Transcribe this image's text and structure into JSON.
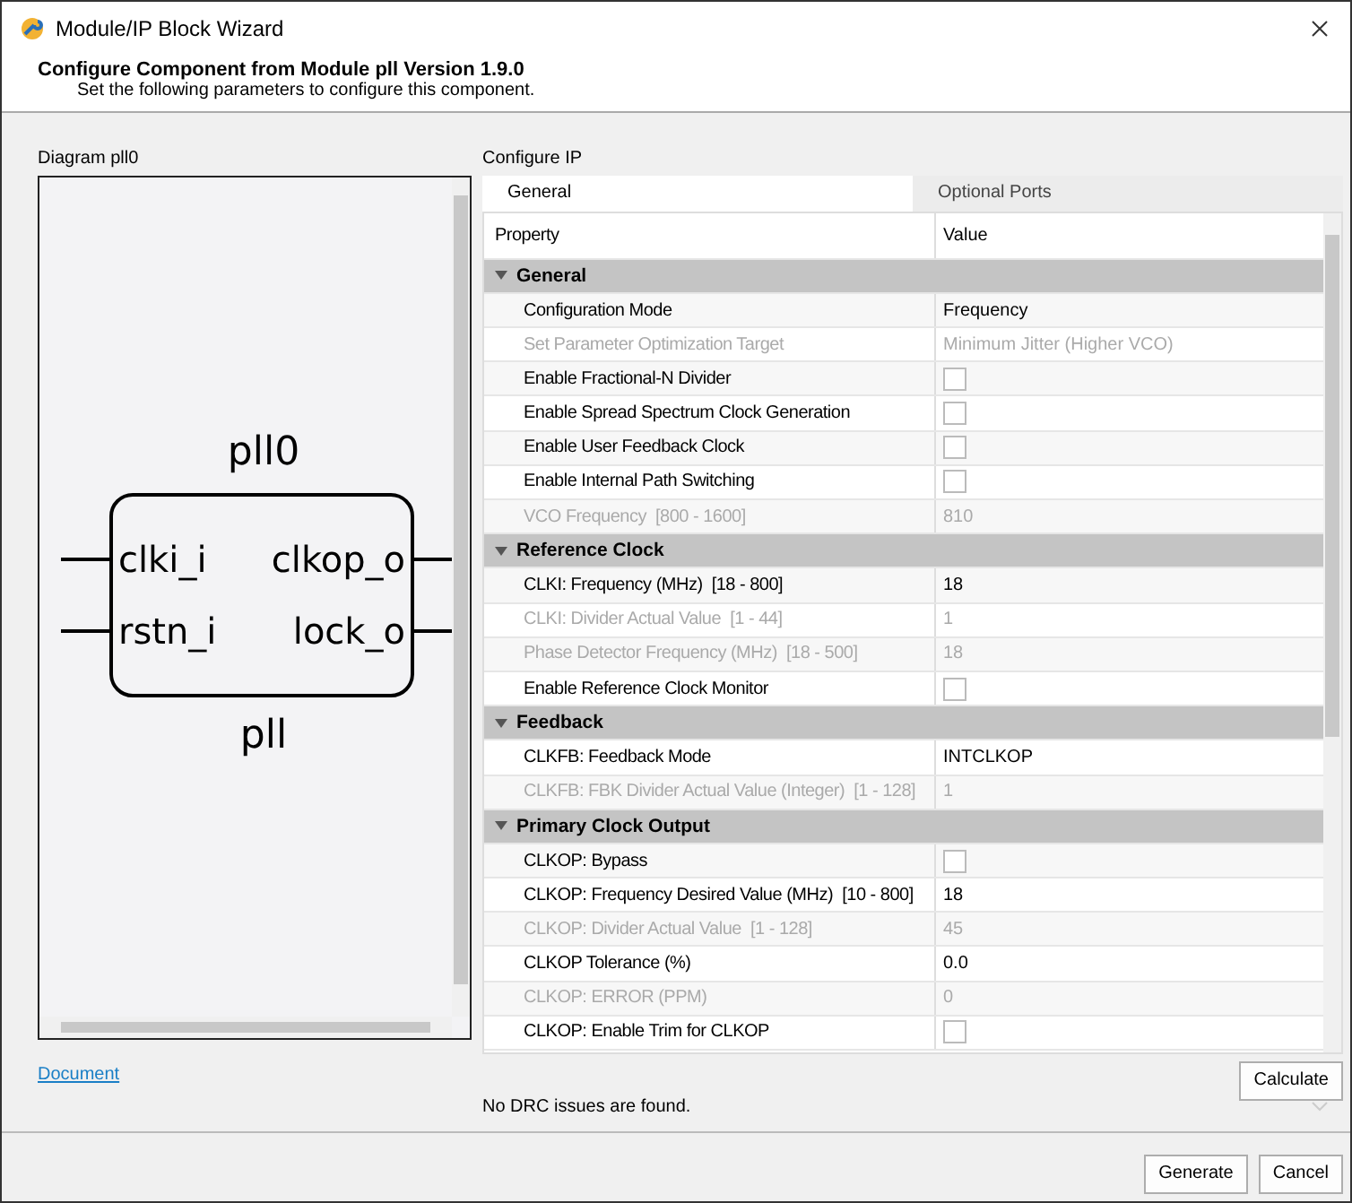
{
  "window": {
    "title": "Module/IP Block Wizard"
  },
  "header": {
    "title": "Configure Component from Module pll Version 1.9.0",
    "subtitle": "Set the following parameters to configure this component."
  },
  "diagram": {
    "label": "Diagram pll0",
    "instance": "pll0",
    "module": "pll",
    "ports_left": [
      "clki_i",
      "rstn_i"
    ],
    "ports_right": [
      "clkop_o",
      "lock_o"
    ]
  },
  "configure": {
    "label": "Configure IP",
    "tabs": [
      {
        "label": "General",
        "selected": true
      },
      {
        "label": "Optional Ports",
        "selected": false
      }
    ],
    "columns": [
      "Property",
      "Value"
    ],
    "rows": [
      {
        "kind": "group",
        "label": "General",
        "expanded": true
      },
      {
        "kind": "text",
        "label": "Configuration Mode",
        "value": "Frequency",
        "disabled": false
      },
      {
        "kind": "text",
        "label": "Set Parameter Optimization Target",
        "value": "Minimum Jitter (Higher VCO)",
        "disabled": true
      },
      {
        "kind": "checkbox",
        "label": "Enable Fractional-N Divider",
        "checked": false,
        "disabled": false
      },
      {
        "kind": "checkbox",
        "label": "Enable Spread Spectrum Clock Generation",
        "checked": false,
        "disabled": false
      },
      {
        "kind": "checkbox",
        "label": "Enable User Feedback Clock",
        "checked": false,
        "disabled": false
      },
      {
        "kind": "checkbox",
        "label": "Enable Internal Path Switching",
        "checked": false,
        "disabled": false
      },
      {
        "kind": "text",
        "label": "VCO Frequency  [800 - 1600]",
        "value": "810",
        "disabled": true
      },
      {
        "kind": "group",
        "label": "Reference Clock",
        "expanded": true
      },
      {
        "kind": "text",
        "label": "CLKI: Frequency (MHz)  [18 - 800]",
        "value": "18",
        "disabled": false
      },
      {
        "kind": "text",
        "label": "CLKI: Divider Actual Value  [1 - 44]",
        "value": "1",
        "disabled": true
      },
      {
        "kind": "text",
        "label": "Phase Detector Frequency (MHz)  [18 - 500]",
        "value": "18",
        "disabled": true
      },
      {
        "kind": "checkbox",
        "label": "Enable Reference Clock Monitor",
        "checked": false,
        "disabled": false
      },
      {
        "kind": "group",
        "label": "Feedback",
        "expanded": true
      },
      {
        "kind": "text",
        "label": "CLKFB: Feedback Mode",
        "value": "INTCLKOP",
        "disabled": false
      },
      {
        "kind": "text",
        "label": "CLKFB: FBK Divider Actual Value (Integer)  [1 - 128]",
        "value": "1",
        "disabled": true
      },
      {
        "kind": "group",
        "label": "Primary Clock Output",
        "expanded": true
      },
      {
        "kind": "checkbox",
        "label": "CLKOP: Bypass",
        "checked": false,
        "disabled": false
      },
      {
        "kind": "text",
        "label": "CLKOP: Frequency Desired Value (MHz)  [10 - 800]",
        "value": "18",
        "disabled": false
      },
      {
        "kind": "text",
        "label": "CLKOP: Divider Actual Value  [1 - 128]",
        "value": "45",
        "disabled": true
      },
      {
        "kind": "text",
        "label": "CLKOP Tolerance (%)",
        "value": "0.0",
        "disabled": false
      },
      {
        "kind": "text",
        "label": "CLKOP: ERROR (PPM)",
        "value": "0",
        "disabled": true
      },
      {
        "kind": "checkbox",
        "label": "CLKOP: Enable Trim for CLKOP",
        "checked": false,
        "disabled": false
      }
    ],
    "calculate": "Calculate",
    "status": "No DRC issues are found."
  },
  "document_link": "Document",
  "buttons": [
    "Generate",
    "Cancel"
  ]
}
